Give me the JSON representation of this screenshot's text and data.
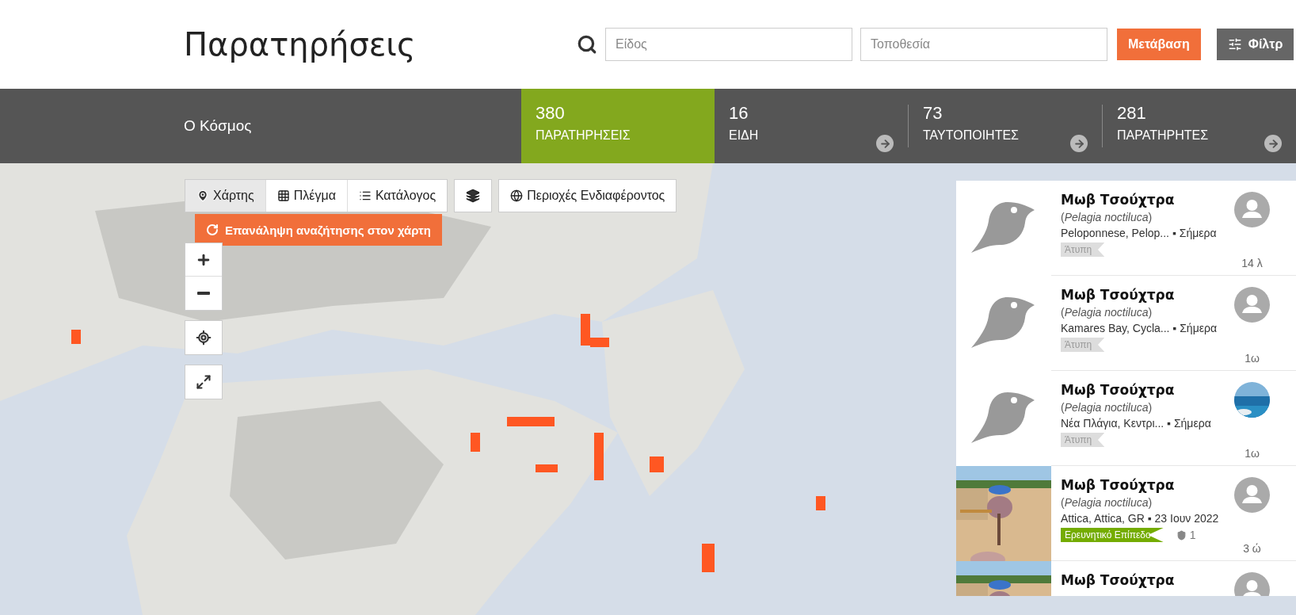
{
  "header": {
    "title": "Παρατηρήσεις",
    "species_field": {
      "placeholder": "Είδος"
    },
    "location_field": {
      "placeholder": "Τοποθεσία"
    },
    "go_button": "Μετάβαση",
    "filters_button": "Φίλτρ"
  },
  "stats_bar": {
    "place": "Ο Κόσμος",
    "items": [
      {
        "count": "380",
        "label": "ΠΑΡΑΤΗΡΗΣΕΙΣ",
        "selected": true
      },
      {
        "count": "16",
        "label": "ΕΙΔΗ",
        "selected": false
      },
      {
        "count": "73",
        "label": "ΤΑΥΤΟΠΟΙΗΤΕΣ",
        "selected": false
      },
      {
        "count": "281",
        "label": "ΠΑΡΑΤΗΡΗΤΕΣ",
        "selected": false
      }
    ]
  },
  "map": {
    "kind": "picture",
    "view_tabs": [
      {
        "label": "Χάρτης",
        "kind": "map",
        "selected": true
      },
      {
        "label": "Πλέγμα",
        "kind": "grid",
        "selected": false
      },
      {
        "label": "Κατάλογος",
        "kind": "list",
        "selected": false
      }
    ],
    "areas_button": "Περιοχές Ενδιαφέροντος",
    "redo_search_button": "Επανάληψη αναζήτησης στον χάρτη"
  },
  "observations": [
    {
      "common_name": "Μωβ Τσούχτρα",
      "scientific_name": "(*Pelagia noctiluca*)",
      "place": "Peloponnese, Pelop...",
      "separator": "▪",
      "date": "Σήμερα",
      "quality": {
        "label": "Άτυπη",
        "kind": "casual"
      },
      "time": "14 λ",
      "photo": {
        "kind": "placeholder"
      },
      "avatar": {
        "kind": "default"
      }
    },
    {
      "common_name": "Μωβ Τσούχτρα",
      "scientific_name": "(*Pelagia noctiluca*)",
      "place": "Kamares Bay, Cycla...",
      "separator": "▪",
      "date": "Σήμερα",
      "quality": {
        "label": "Άτυπη",
        "kind": "casual"
      },
      "time": "1ω",
      "photo": {
        "kind": "placeholder"
      },
      "avatar": {
        "kind": "default"
      }
    },
    {
      "common_name": "Μωβ Τσούχτρα",
      "scientific_name": "(*Pelagia noctiluca*)",
      "place": "Νέα Πλάγια, Κεντρι...",
      "separator": "▪",
      "date": "Σήμερα",
      "quality": {
        "label": "Άτυπη",
        "kind": "casual"
      },
      "time": "1ω",
      "photo": {
        "kind": "placeholder"
      }
    },
    {
      "common_name": "Μωβ Τσούχτρα",
      "scientific_name": "(*Pelagia noctiluca*)",
      "place": "Attica, Attica, GR",
      "separator": "▪",
      "date": "23 Ιουν 2022",
      "quality": {
        "label": "Ερευνητικό Επίπεδο",
        "kind": "research"
      },
      "identifications": "1",
      "time": "3 ώ",
      "avatar": {
        "kind": "default"
      }
    },
    {
      "common_name": "Μωβ Τσούχτρα",
      "avatar": {
        "kind": "default"
      }
    }
  ]
}
